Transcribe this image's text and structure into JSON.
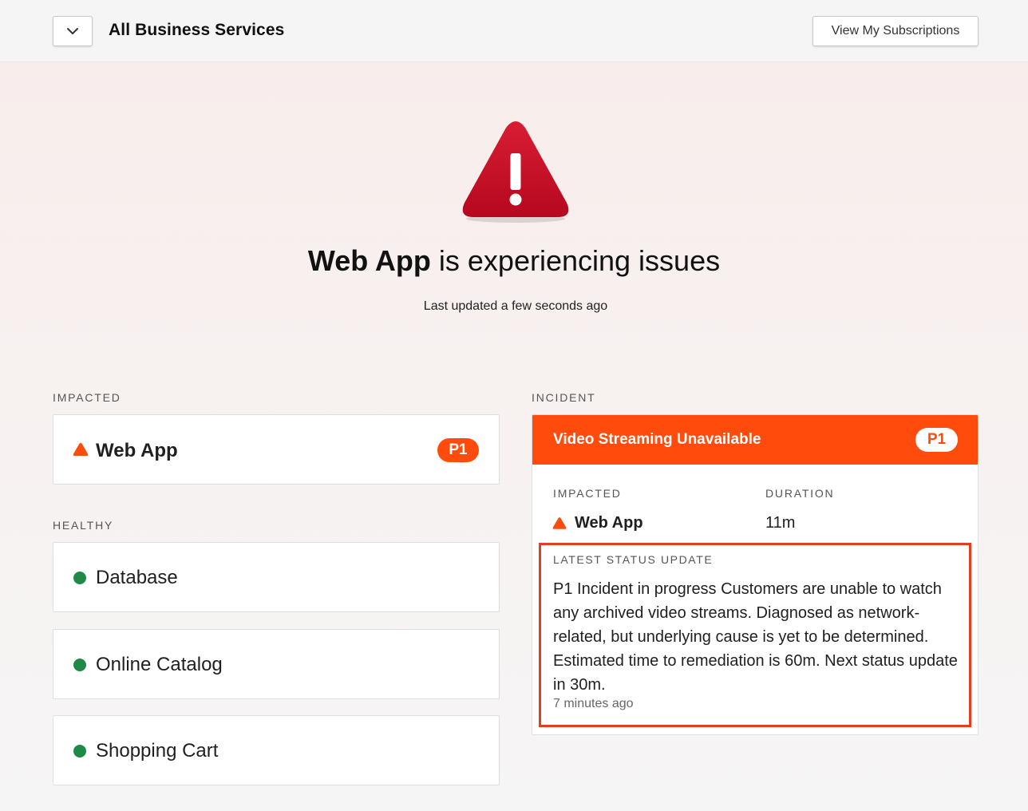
{
  "header": {
    "title": "All Business Services",
    "subscriptions_label": "View My Subscriptions",
    "dropdown_icon": "chevron-down-icon"
  },
  "hero": {
    "icon": "warning-triangle-icon",
    "service": "Web App",
    "status_text": "is experiencing issues",
    "last_updated": "Last updated a few seconds ago"
  },
  "impacted": {
    "label": "IMPACTED",
    "services": [
      {
        "name": "Web App",
        "priority": "P1",
        "icon": "warning-triangle-icon"
      }
    ]
  },
  "healthy": {
    "label": "HEALTHY",
    "services": [
      {
        "name": "Database"
      },
      {
        "name": "Online Catalog"
      },
      {
        "name": "Shopping Cart"
      }
    ]
  },
  "incident": {
    "label": "INCIDENT",
    "title": "Video Streaming Unavailable",
    "priority": "P1",
    "impacted_label": "IMPACTED",
    "impacted_service": "Web App",
    "duration_label": "DURATION",
    "duration": "11m",
    "status_update_label": "LATEST STATUS UPDATE",
    "status_update_text": "P1 Incident in progress Customers are unable to watch any archived video streams. Diagnosed as network-related, but underlying cause is yet to be determined. Estimated time to remediation is 60m. Next status update in 30m.",
    "status_update_time": "7 minutes ago"
  },
  "colors": {
    "accent_orange": "#ff4b0c",
    "healthy_green": "#1f8a47",
    "hero_red": "#c4102a",
    "highlight_border": "#e43d1f"
  }
}
